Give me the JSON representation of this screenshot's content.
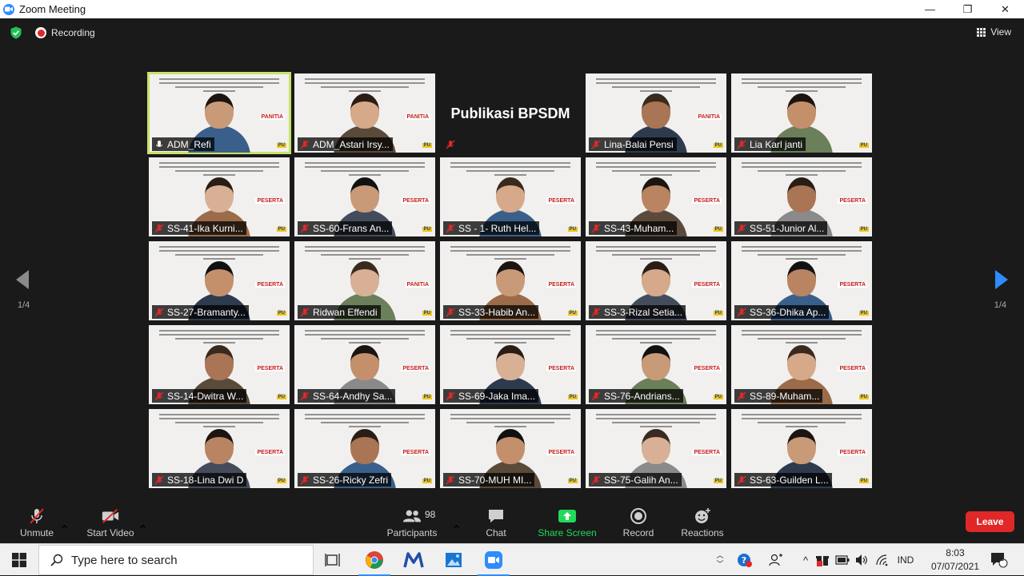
{
  "window": {
    "title": "Zoom Meeting",
    "controls": [
      "—",
      "❐",
      "✕"
    ]
  },
  "meeting": {
    "recording_label": "Recording",
    "view_label": "View",
    "page_left": "1/4",
    "page_right": "1/4"
  },
  "tiles": [
    {
      "name": "ADM_Refi",
      "role": "PANITIA",
      "speaker": true
    },
    {
      "name": "ADM_Astari Irsy...",
      "role": "PANITIA"
    },
    {
      "name": "",
      "title": "Publikasi BPSDM"
    },
    {
      "name": "Lina-Balai Pensi",
      "role": "PANITIA"
    },
    {
      "name": "Lia Karl janti",
      "role": ""
    },
    {
      "name": "SS-41-Ika Kurni...",
      "role": "PESERTA"
    },
    {
      "name": "SS-60-Frans An...",
      "role": "PESERTA"
    },
    {
      "name": "SS - 1- Ruth Hel...",
      "role": "PESERTA"
    },
    {
      "name": "SS-43-Muham...",
      "role": "PESERTA"
    },
    {
      "name": "SS-51-Junior Al...",
      "role": "PESERTA"
    },
    {
      "name": "SS-27-Bramanty...",
      "role": "PESERTA"
    },
    {
      "name": "Ridwan Effendi",
      "role": "PANITIA"
    },
    {
      "name": "SS-33-Habib An...",
      "role": "PESERTA"
    },
    {
      "name": "SS-3-Rizal Setia...",
      "role": "PESERTA"
    },
    {
      "name": "SS-36-Dhika Ap...",
      "role": "PESERTA"
    },
    {
      "name": "SS-14-Dwitra W...",
      "role": "PESERTA"
    },
    {
      "name": "SS-64-Andhy Sa...",
      "role": "PESERTA"
    },
    {
      "name": "SS-69-Jaka Ima...",
      "role": "PESERTA"
    },
    {
      "name": "SS-76-Andrians...",
      "role": "PESERTA"
    },
    {
      "name": "SS-89-Muham...",
      "role": "PESERTA"
    },
    {
      "name": "SS-18-Lina Dwi D",
      "role": "PESERTA"
    },
    {
      "name": "SS-26-Ricky Zefri",
      "role": "PESERTA"
    },
    {
      "name": "SS-70-MUH MI...",
      "role": "PESERTA"
    },
    {
      "name": "SS-75-Galih An...",
      "role": "PESERTA"
    },
    {
      "name": "SS-63-Guilden L...",
      "role": "PESERTA"
    }
  ],
  "slide_logo": "PU",
  "toolbar": {
    "unmute": "Unmute",
    "start_video": "Start Video",
    "participants": "Participants",
    "participant_count": "98",
    "chat": "Chat",
    "share_screen": "Share Screen",
    "record": "Record",
    "reactions": "Reactions",
    "leave": "Leave"
  },
  "taskbar": {
    "search_placeholder": "Type here to search",
    "language": "IND",
    "time": "8:03",
    "date": "07/07/2021",
    "notification_count": "1"
  },
  "colors": {
    "accent": "#2d8cff",
    "leave": "#e02828",
    "share": "#23d959",
    "speaker_outline": "#c8e36a"
  }
}
